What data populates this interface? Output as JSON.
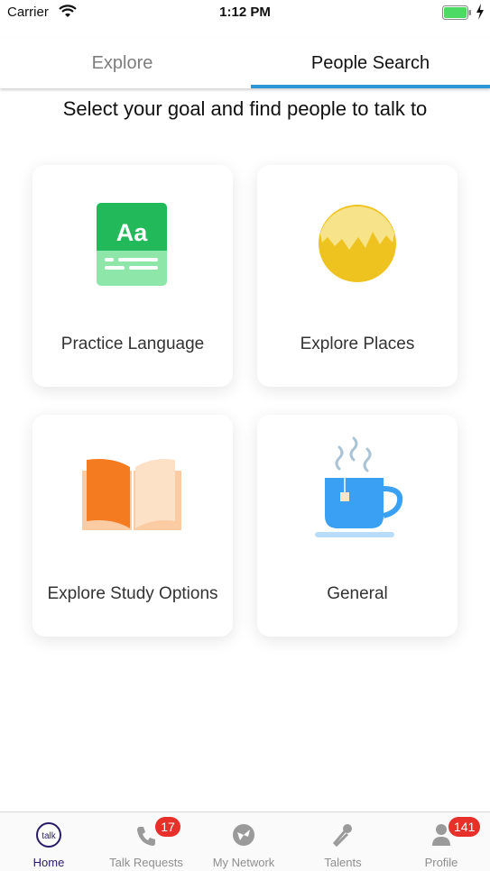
{
  "status_bar": {
    "carrier": "Carrier",
    "time": "1:12 PM",
    "wifi_icon": "wifi-icon",
    "battery_icon": "battery-icon",
    "battery_color": "#4cd964"
  },
  "tabs": [
    {
      "label": "Explore",
      "active": false
    },
    {
      "label": "People Search",
      "active": true
    }
  ],
  "accent_color": "#2b97d6",
  "heading": "Select your goal and find people to talk to",
  "goals": [
    {
      "label": "Practice Language",
      "icon": "language-book-icon"
    },
    {
      "label": "Explore Places",
      "icon": "globe-icon"
    },
    {
      "label": "Explore Study Options",
      "icon": "open-book-icon"
    },
    {
      "label": "General",
      "icon": "tea-cup-icon"
    }
  ],
  "language_icon_text": "Aa",
  "bottom_nav": [
    {
      "label": "Home",
      "icon": "talk-icon",
      "icon_text": "talk",
      "active": true
    },
    {
      "label": "Talk Requests",
      "icon": "phone-icon",
      "badge": "17"
    },
    {
      "label": "My Network",
      "icon": "network-icon"
    },
    {
      "label": "Talents",
      "icon": "microphone-icon"
    },
    {
      "label": "Profile",
      "icon": "person-icon",
      "badge": "141"
    }
  ],
  "badge_color": "#e8302b"
}
